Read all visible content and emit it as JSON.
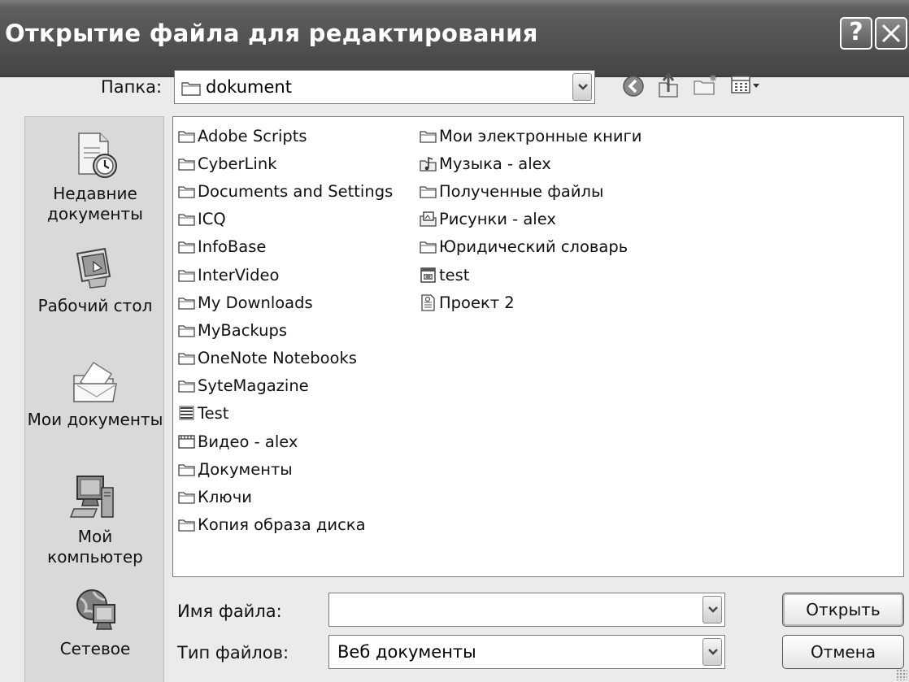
{
  "window": {
    "title": "Открытие файла для редактирования",
    "help_symbol": "?",
    "close_symbol": "✕"
  },
  "lookin": {
    "label": "Папка:",
    "value": "dokument",
    "icons": [
      "folder-icon",
      "back-icon",
      "up-folder-icon",
      "new-folder-icon",
      "view-menu-icon"
    ]
  },
  "places": [
    {
      "label_lines": [
        "Недавние",
        "документы"
      ],
      "icon": "recent-documents-icon"
    },
    {
      "label_lines": [
        "Рабочий стол"
      ],
      "icon": "desktop-icon"
    },
    {
      "label_lines": [
        "Мои документы"
      ],
      "icon": "my-documents-icon"
    },
    {
      "label_lines": [
        "Мой",
        "компьютер"
      ],
      "icon": "my-computer-icon"
    },
    {
      "label_lines": [
        "Сетевое"
      ],
      "icon": "network-icon"
    }
  ],
  "files": {
    "column1": [
      {
        "name": "Adobe Scripts",
        "icon": "folder"
      },
      {
        "name": "CyberLink",
        "icon": "folder"
      },
      {
        "name": "Documents and Settings",
        "icon": "folder"
      },
      {
        "name": "ICQ",
        "icon": "folder"
      },
      {
        "name": "InfoBase",
        "icon": "folder"
      },
      {
        "name": "InterVideo",
        "icon": "folder"
      },
      {
        "name": "My Downloads",
        "icon": "folder"
      },
      {
        "name": "MyBackups",
        "icon": "folder"
      },
      {
        "name": "OneNote Notebooks",
        "icon": "folder"
      },
      {
        "name": "SyteMagazine",
        "icon": "folder"
      },
      {
        "name": "Test",
        "icon": "stack"
      },
      {
        "name": "Видео - alex",
        "icon": "video"
      },
      {
        "name": "Документы",
        "icon": "folder"
      },
      {
        "name": "Ключи",
        "icon": "folder"
      },
      {
        "name": "Копия образа диска",
        "icon": "folder"
      }
    ],
    "column2": [
      {
        "name": "Мои электронные книги",
        "icon": "folder"
      },
      {
        "name": "Музыка - alex",
        "icon": "music"
      },
      {
        "name": "Полученные файлы",
        "icon": "folder"
      },
      {
        "name": "Рисунки - alex",
        "icon": "pictures"
      },
      {
        "name": "Юридический словарь",
        "icon": "folder"
      },
      {
        "name": "test",
        "icon": "html"
      },
      {
        "name": "Проект 2",
        "icon": "project"
      }
    ]
  },
  "filename": {
    "label": "Имя файла:",
    "value": ""
  },
  "filetype": {
    "label": "Тип файлов:",
    "value": "Веб документы"
  },
  "buttons": {
    "open": "Открыть",
    "cancel": "Отмена"
  }
}
